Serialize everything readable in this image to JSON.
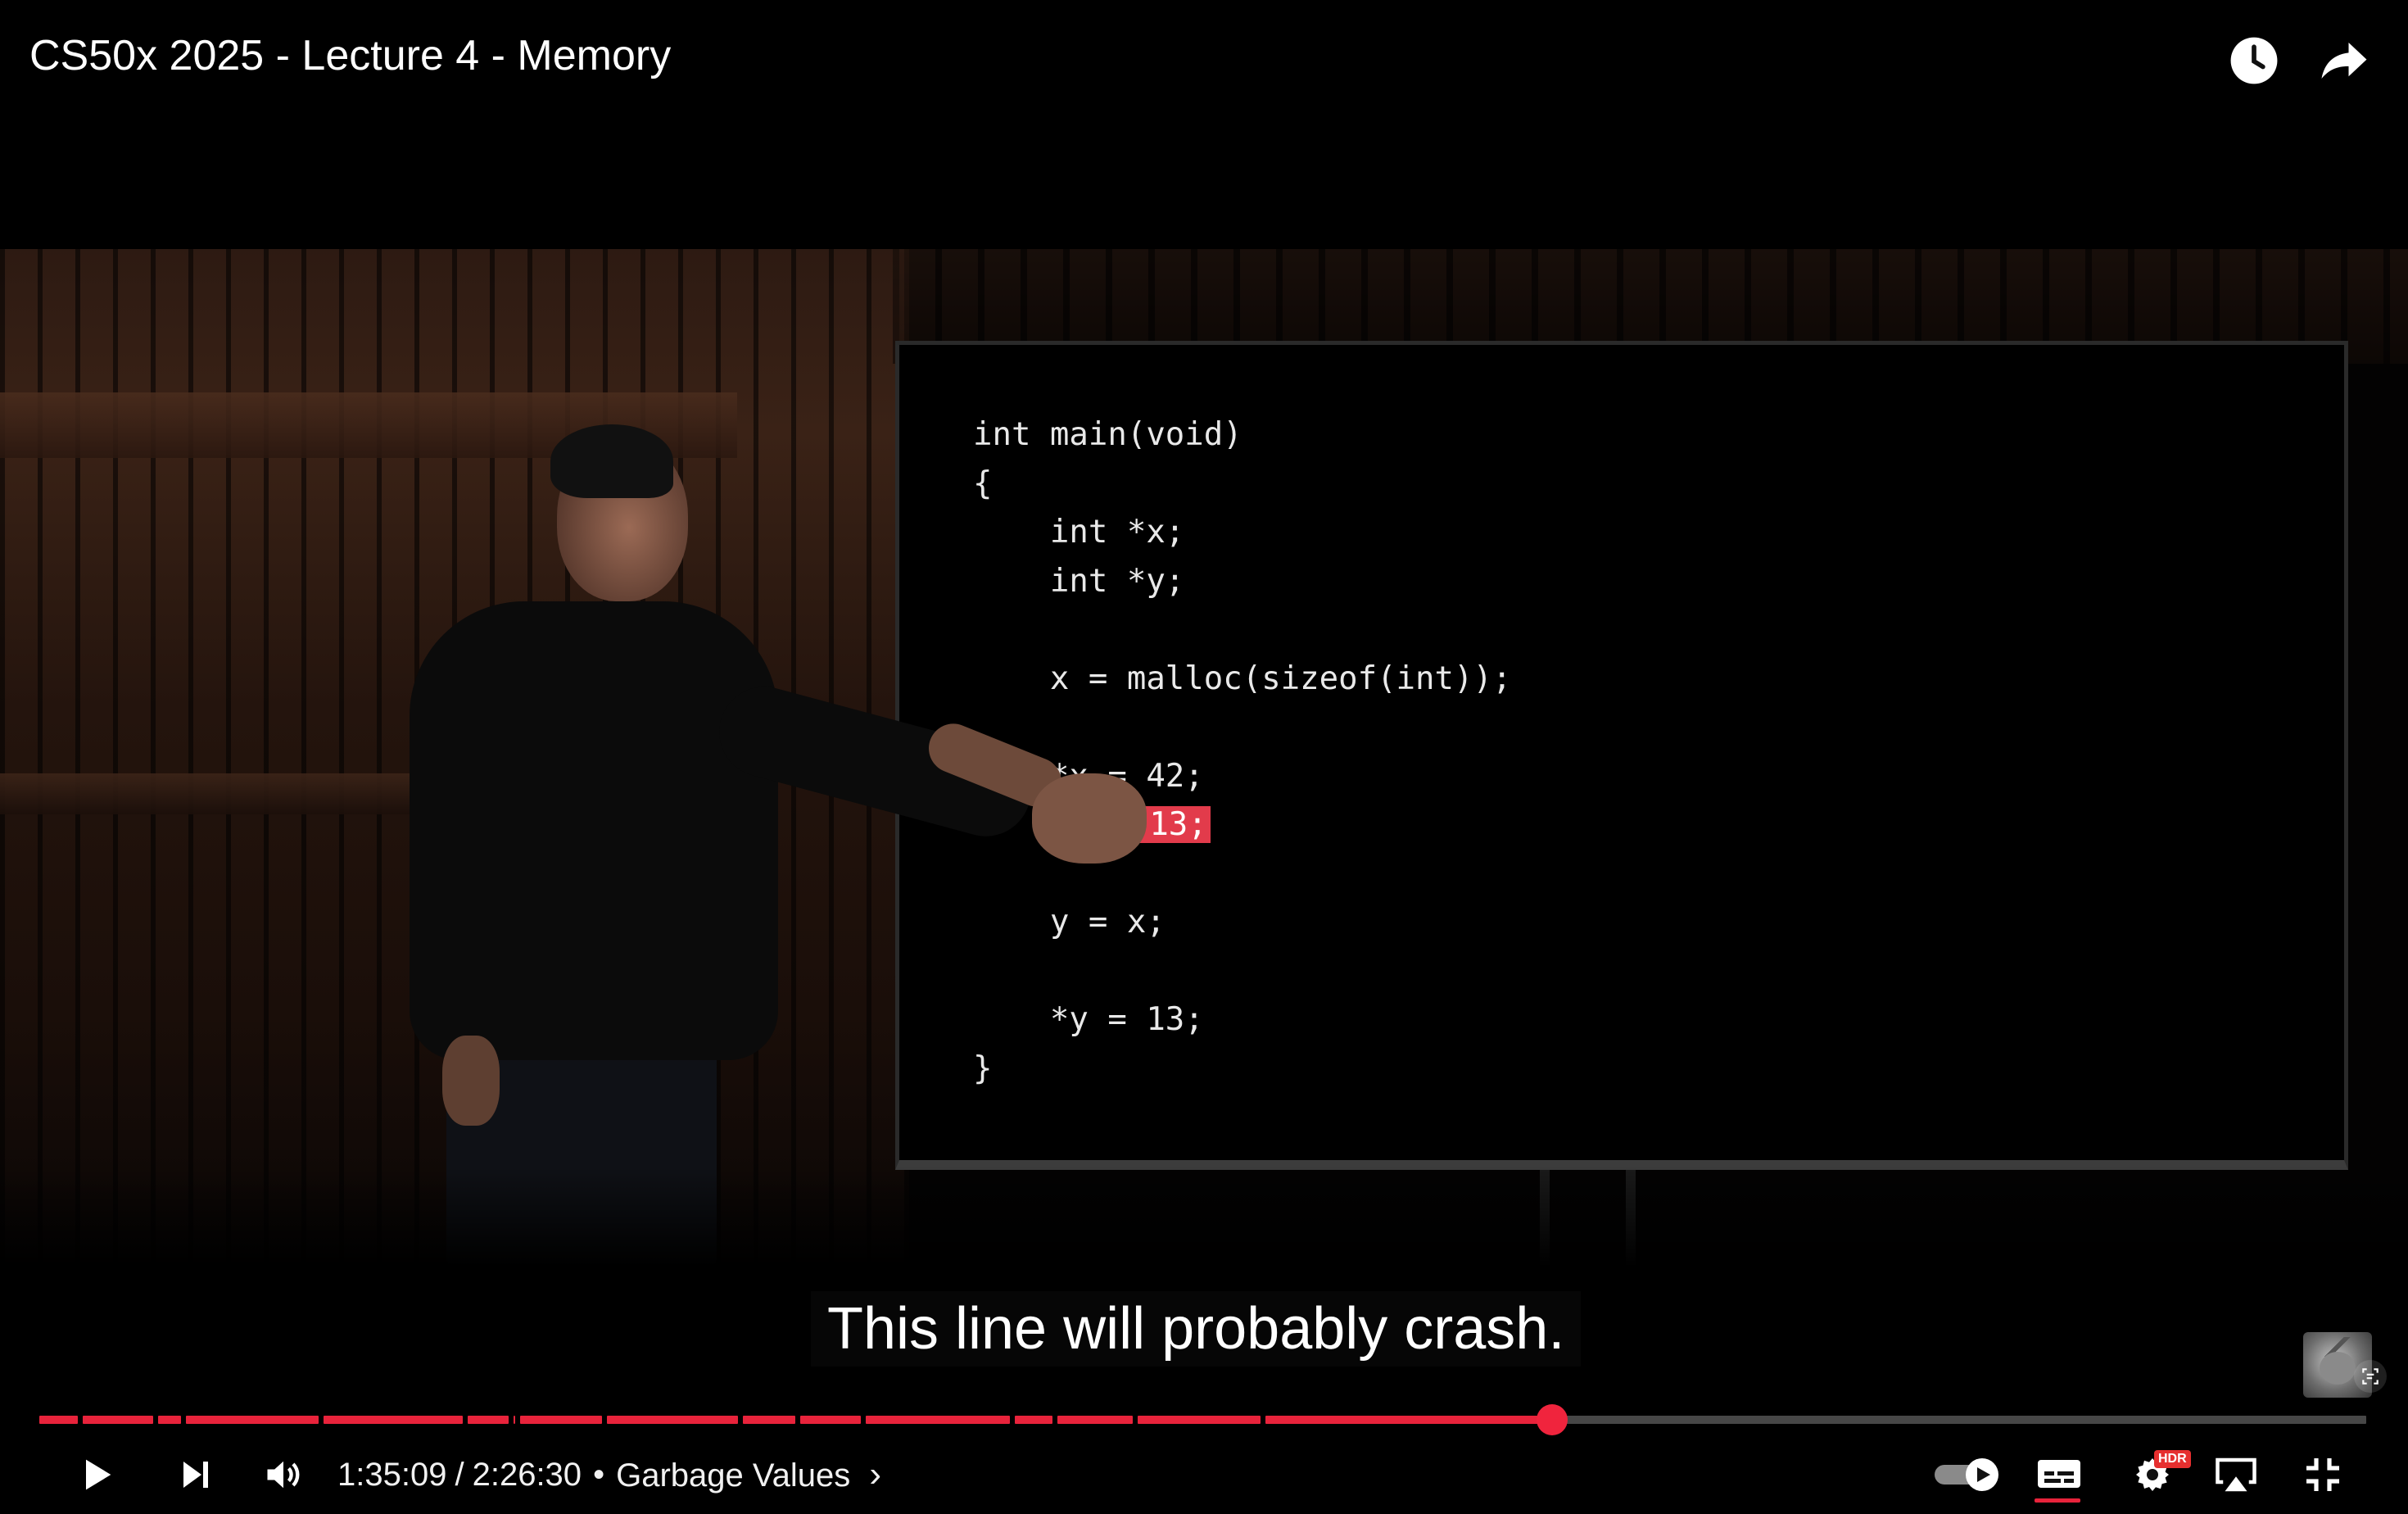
{
  "header": {
    "title": "CS50x 2025 - Lecture 4 - Memory"
  },
  "slide": {
    "code_lines": [
      "int main(void)",
      "{",
      "    int *x;",
      "    int *y;",
      "",
      "    x = malloc(sizeof(int));",
      "",
      "    *x = 42;",
      "    *y = 13;",
      "",
      "    y = x;",
      "",
      "    *y = 13;",
      "}"
    ],
    "highlighted_line_index": 8,
    "highlight_color": "#e23b4b"
  },
  "caption": {
    "text": "This line will probably crash."
  },
  "player": {
    "current_time": "1:35:09",
    "time_separator": "/",
    "duration": "2:26:30",
    "bullet": "•",
    "chapter_title": "Garbage Values",
    "chapter_chevron": "›",
    "progress_fraction": 0.6494,
    "accent_color": "#e8233b",
    "hdr_badge": "HDR",
    "autoplay": "on",
    "captions": "on"
  },
  "icons": {
    "watch_later": "clock-icon",
    "share": "share-arrow-icon",
    "play": "play-icon",
    "next": "skip-next-icon",
    "volume": "volume-icon",
    "autoplay": "autoplay-toggle-icon",
    "subtitles": "subtitles-icon",
    "settings": "settings-gear-icon",
    "airplay": "airplay-icon",
    "fullscreen_exit": "fullscreen-exit-icon",
    "lens": "lens-icon"
  }
}
